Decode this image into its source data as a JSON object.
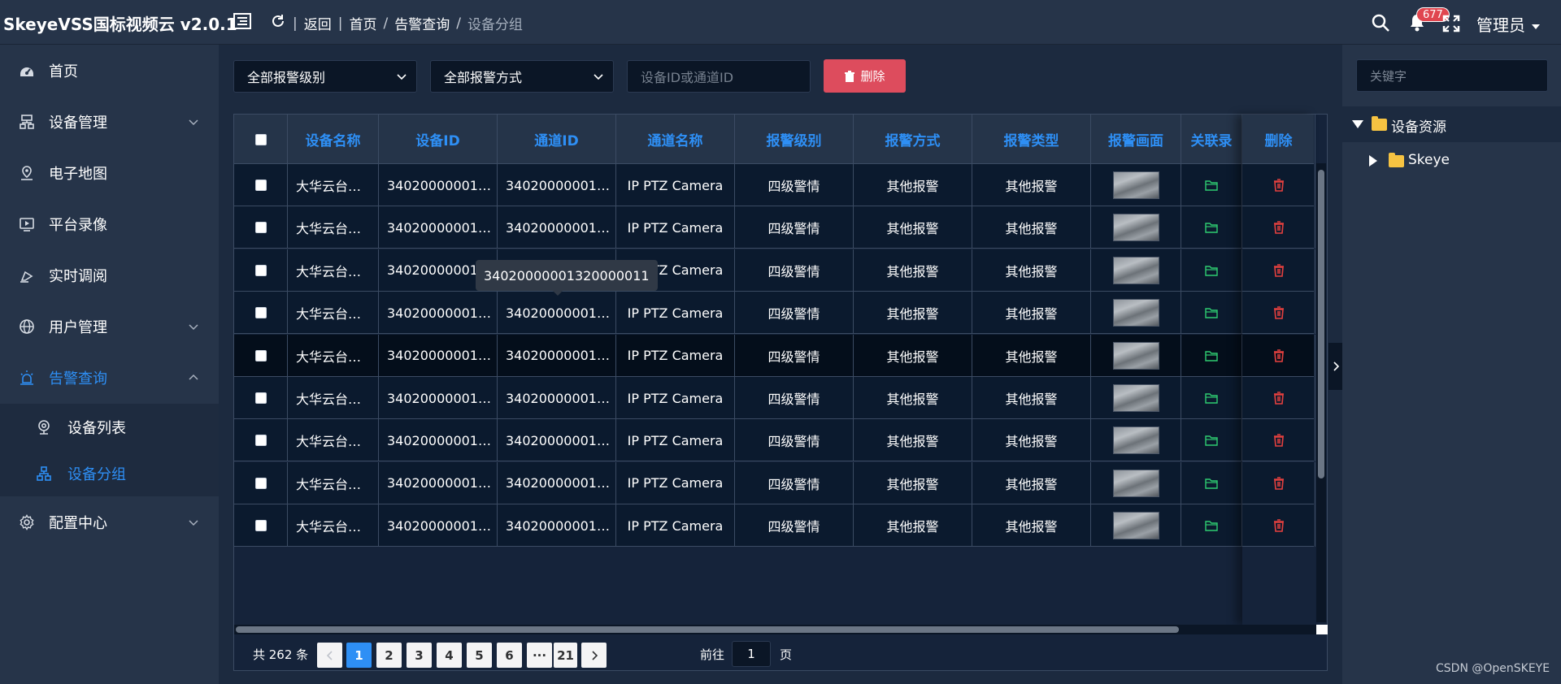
{
  "app": {
    "title": "SkeyeVSS国标视频云 v2.0.1"
  },
  "breadcrumb": {
    "back": "返回",
    "items": [
      "首页",
      "告警查询",
      "设备分组"
    ]
  },
  "header": {
    "notification_count": "677",
    "user": "管理员"
  },
  "sidebar": {
    "items": [
      {
        "label": "首页",
        "icon": "dashboard-icon"
      },
      {
        "label": "设备管理",
        "icon": "server-icon"
      },
      {
        "label": "电子地图",
        "icon": "map-pin-icon"
      },
      {
        "label": "平台录像",
        "icon": "video-icon"
      },
      {
        "label": "实时调阅",
        "icon": "live-icon"
      },
      {
        "label": "用户管理",
        "icon": "globe-icon"
      },
      {
        "label": "告警查询",
        "icon": "alarm-icon"
      },
      {
        "label": "配置中心",
        "icon": "gear-icon"
      }
    ],
    "submenu": [
      {
        "label": "设备列表",
        "icon": "camera-icon"
      },
      {
        "label": "设备分组",
        "icon": "group-icon"
      }
    ]
  },
  "filters": {
    "level": "全部报警级别",
    "method": "全部报警方式",
    "search_placeholder": "设备ID或通道ID",
    "delete": "删除"
  },
  "table": {
    "headers": [
      "设备名称",
      "设备ID",
      "通道ID",
      "通道名称",
      "报警级别",
      "报警方式",
      "报警类型",
      "报警画面",
      "关联录",
      "删除"
    ],
    "rows": [
      {
        "name": "大华云台…",
        "device_id": "34020000001…",
        "channel_id": "34020000001…",
        "channel_name": "IP PTZ Camera",
        "level": "四级警情",
        "method": "其他报警",
        "type": "其他报警"
      },
      {
        "name": "大华云台…",
        "device_id": "34020000001…",
        "channel_id": "34020000001…",
        "channel_name": "IP PTZ Camera",
        "level": "四级警情",
        "method": "其他报警",
        "type": "其他报警"
      },
      {
        "name": "大华云台…",
        "device_id": "34020000001…",
        "channel_id": "34020000001…",
        "channel_name": "IP PTZ Camera",
        "level": "四级警情",
        "method": "其他报警",
        "type": "其他报警"
      },
      {
        "name": "大华云台…",
        "device_id": "34020000001…",
        "channel_id": "34020000001…",
        "channel_name": "IP PTZ Camera",
        "level": "四级警情",
        "method": "其他报警",
        "type": "其他报警"
      },
      {
        "name": "大华云台…",
        "device_id": "34020000001…",
        "channel_id": "34020000001…",
        "channel_name": "IP PTZ Camera",
        "level": "四级警情",
        "method": "其他报警",
        "type": "其他报警"
      },
      {
        "name": "大华云台…",
        "device_id": "34020000001…",
        "channel_id": "34020000001…",
        "channel_name": "IP PTZ Camera",
        "level": "四级警情",
        "method": "其他报警",
        "type": "其他报警"
      },
      {
        "name": "大华云台…",
        "device_id": "34020000001…",
        "channel_id": "34020000001…",
        "channel_name": "IP PTZ Camera",
        "level": "四级警情",
        "method": "其他报警",
        "type": "其他报警"
      },
      {
        "name": "大华云台…",
        "device_id": "34020000001…",
        "channel_id": "34020000001…",
        "channel_name": "IP PTZ Camera",
        "level": "四级警情",
        "method": "其他报警",
        "type": "其他报警"
      },
      {
        "name": "大华云台…",
        "device_id": "34020000001…",
        "channel_id": "34020000001…",
        "channel_name": "IP PTZ Camera",
        "level": "四级警情",
        "method": "其他报警",
        "type": "其他报警"
      }
    ],
    "tooltip": "34020000001320000011"
  },
  "pagination": {
    "total": "共 262 条",
    "pages": [
      "1",
      "2",
      "3",
      "4",
      "5",
      "6",
      "···",
      "21"
    ],
    "current": "1",
    "goto_prefix": "前往",
    "goto_value": "1",
    "goto_suffix": "页"
  },
  "tree": {
    "search_placeholder": "关键字",
    "root": "设备资源",
    "child": "Skeye"
  },
  "watermark": "CSDN @OpenSKEYE",
  "colors": {
    "accent": "#2e8ff5",
    "danger": "#dd4c5d",
    "folder": "#f6c342",
    "link_icon": "#2ecc71"
  }
}
